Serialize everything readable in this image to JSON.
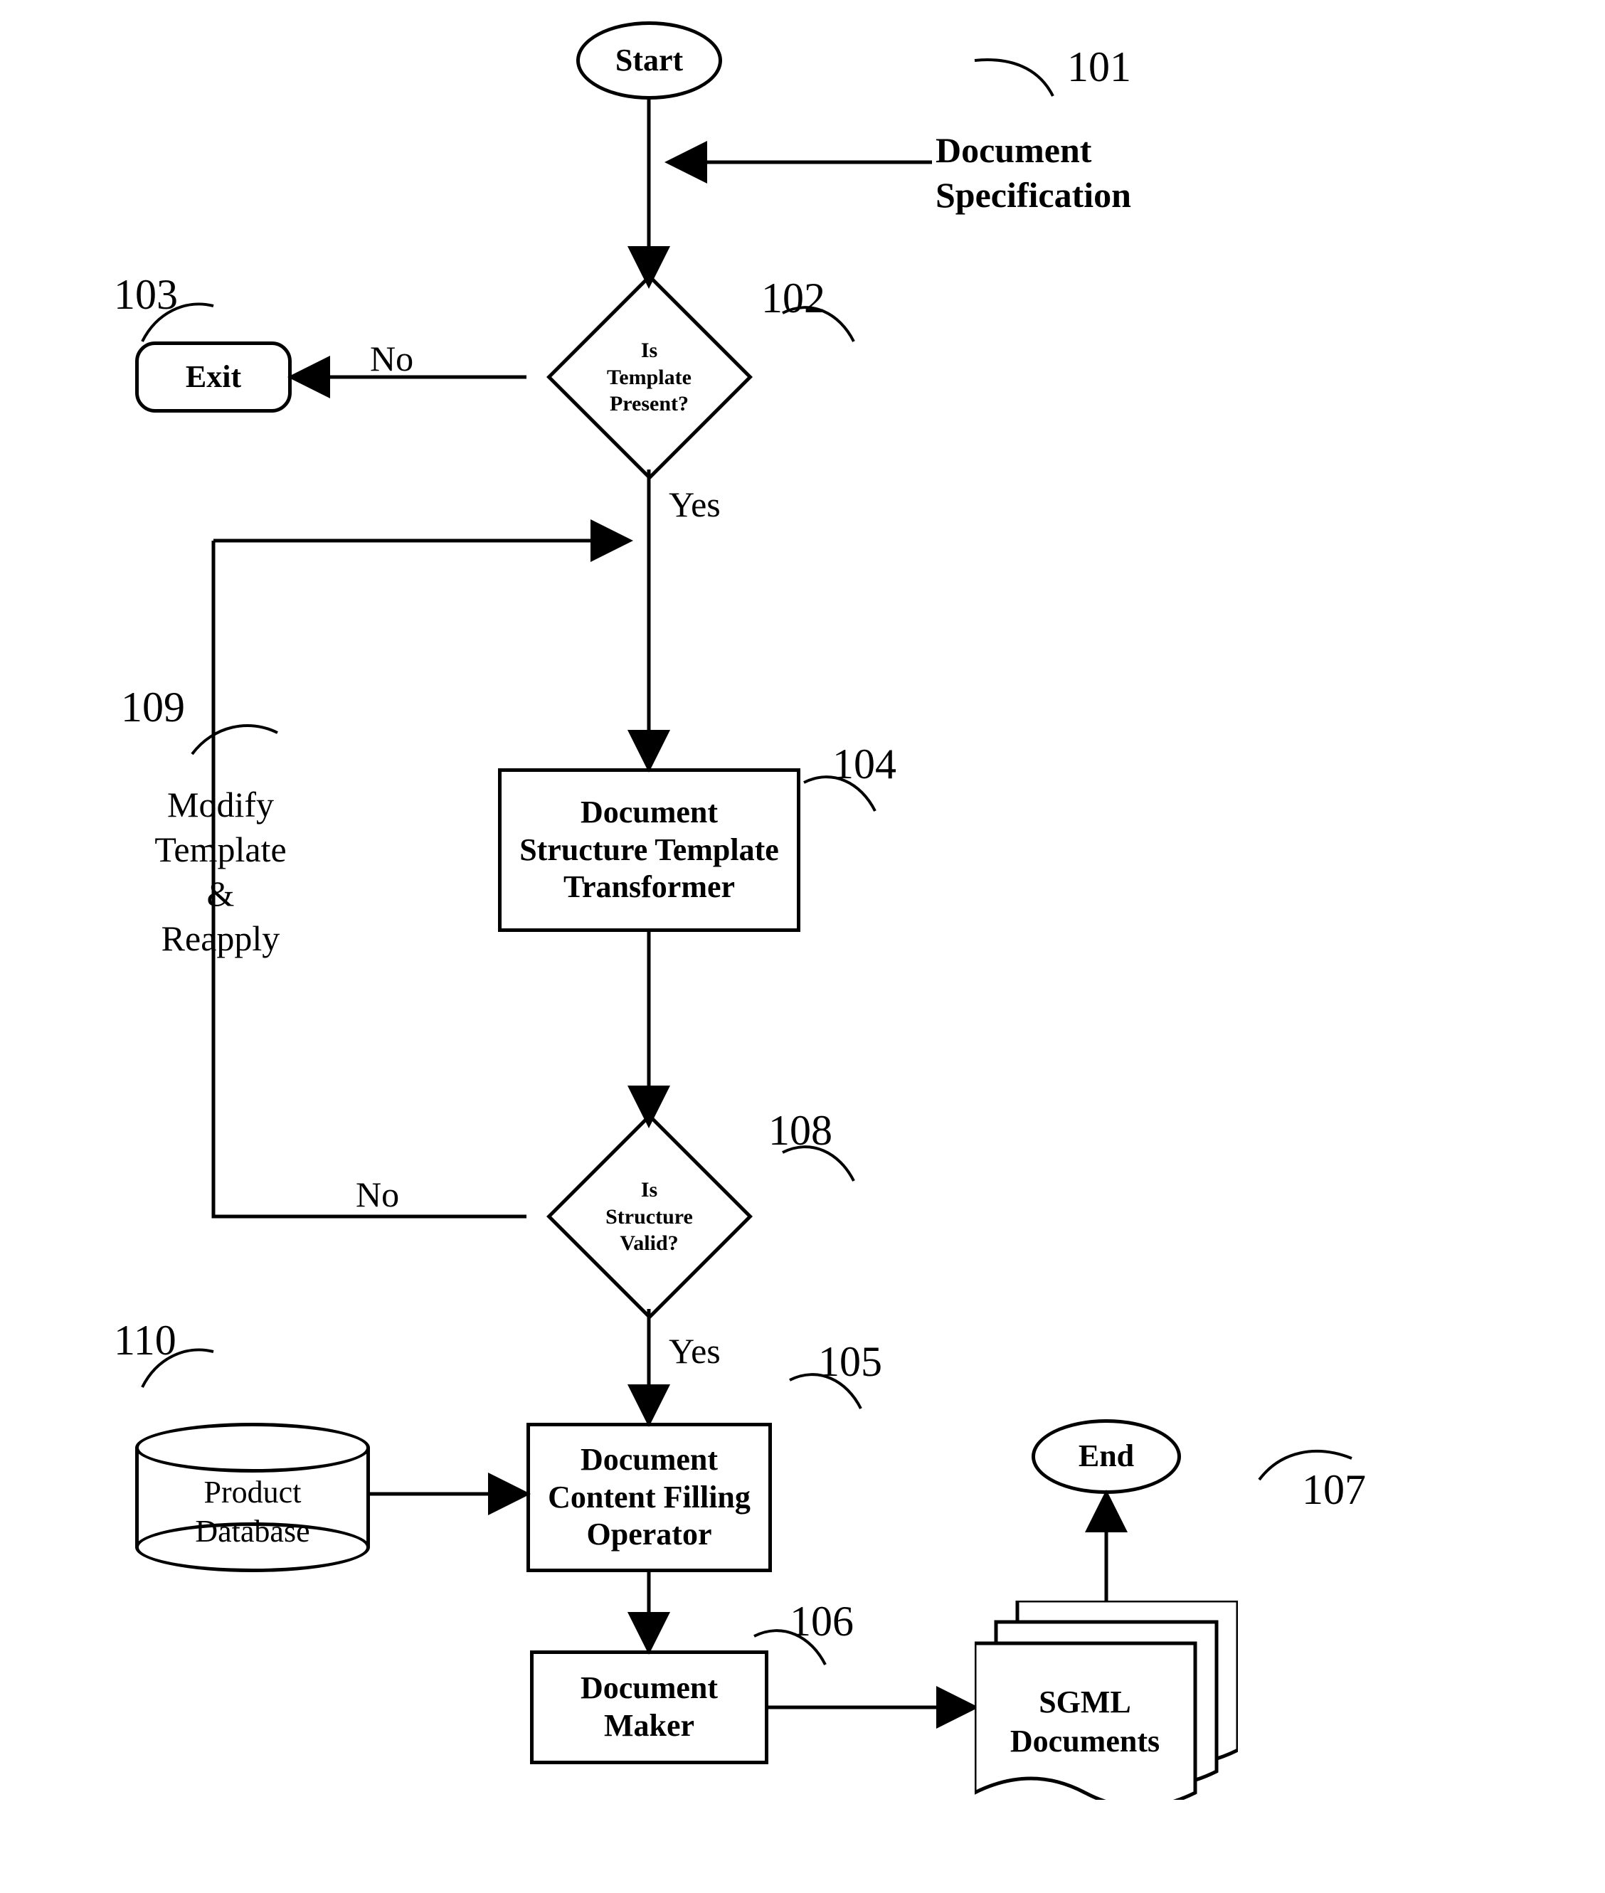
{
  "nodes": {
    "start": "Start",
    "doc_spec_line1": "Document",
    "doc_spec_line2": "Specification",
    "decision_template_l1": "Is",
    "decision_template_l2": "Template",
    "decision_template_l3": "Present?",
    "exit": "Exit",
    "transformer_l1": "Document",
    "transformer_l2": "Structure Template",
    "transformer_l3": "Transformer",
    "decision_valid_l1": "Is",
    "decision_valid_l2": "Structure",
    "decision_valid_l3": "Valid?",
    "modify_l1": "Modify",
    "modify_l2": "Template",
    "modify_l3": "&",
    "modify_l4": "Reapply",
    "product_db_l1": "Product",
    "product_db_l2": "Database",
    "filler_l1": "Document",
    "filler_l2": "Content Filling",
    "filler_l3": "Operator",
    "maker_l1": "Document",
    "maker_l2": "Maker",
    "sgml_l1": "SGML",
    "sgml_l2": "Documents",
    "end": "End"
  },
  "edge_labels": {
    "no1": "No",
    "yes1": "Yes",
    "no2": "No",
    "yes2": "Yes"
  },
  "refs": {
    "r101": "101",
    "r102": "102",
    "r103": "103",
    "r104": "104",
    "r105": "105",
    "r106": "106",
    "r107": "107",
    "r108": "108",
    "r109": "109",
    "r110": "110"
  }
}
